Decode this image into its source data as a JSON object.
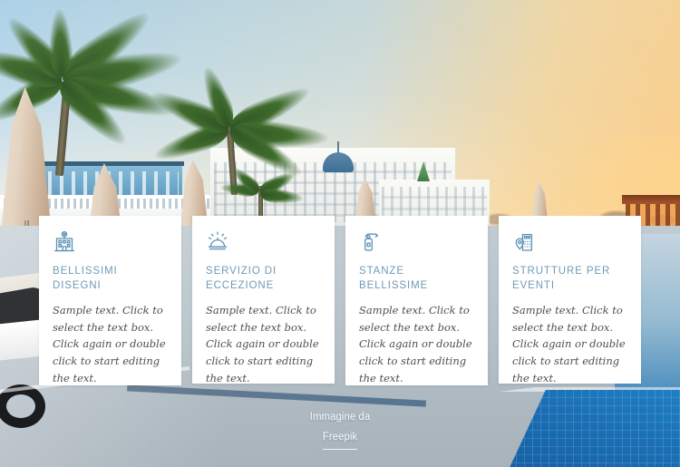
{
  "background": {
    "scene_description": "Hotel resort pool deck at sunset with palm trees, closed beach umbrellas and a white hotel building",
    "sky_color": "#a8cfe6",
    "sunset_color": "#fad696",
    "pool_color": "#1a6fb4",
    "deck_color": "#b9c4cc"
  },
  "cards": [
    {
      "icon": "hotel-building-icon",
      "title": "BELLISSIMI DISEGNI",
      "text": "Sample text. Click to select the text box. Click again or double click to start editing the text."
    },
    {
      "icon": "service-bell-icon",
      "title": "SERVIZIO DI ECCEZIONE",
      "text": "Sample text. Click to select the text box. Click again or double click to start editing the text."
    },
    {
      "icon": "door-hanger-icon",
      "title": "STANZE BELLISSIME",
      "text": "Sample text. Click to select the text box. Click again or double click to start editing the text."
    },
    {
      "icon": "event-venue-pin-icon",
      "title": "STRUTTURE PER EVENTI",
      "text": "Sample text. Click to select the text box. Click again or double click to start editing the text."
    }
  ],
  "credit": {
    "prefix": "Immagine da",
    "link_label": "Freepik"
  },
  "colors": {
    "card_background": "#ffffff",
    "title_color": "#6f9ab7",
    "body_color": "#4e4e4e",
    "icon_color": "#5b91b5"
  }
}
